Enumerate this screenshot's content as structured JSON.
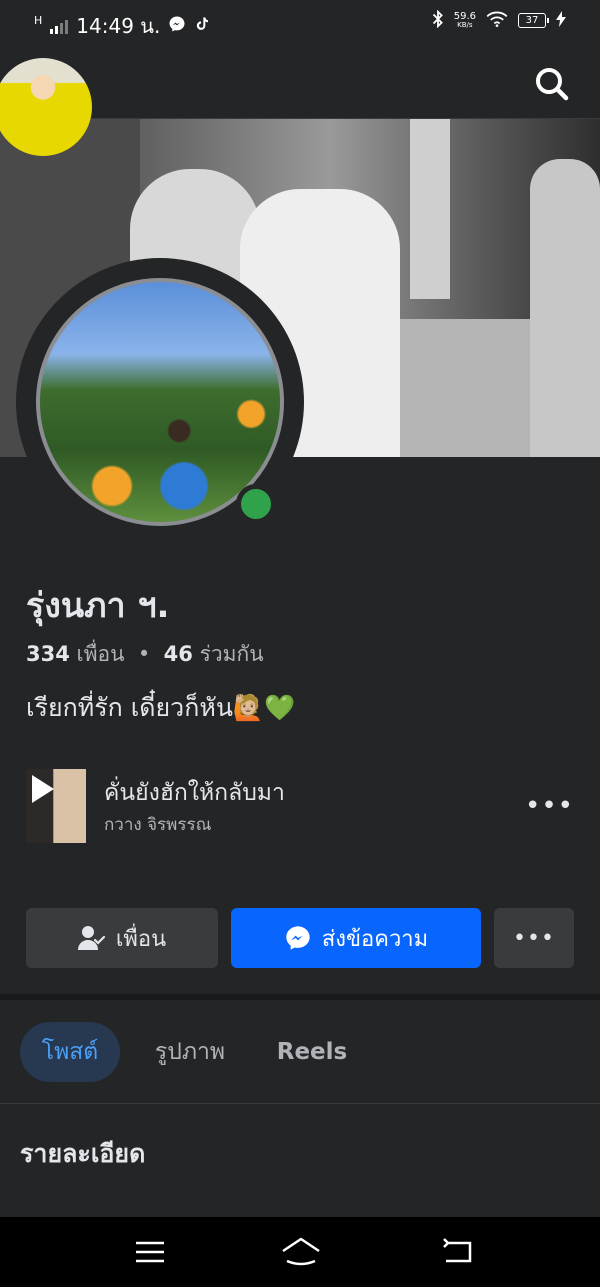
{
  "status_bar": {
    "network": "H",
    "time": "14:49 น.",
    "data_speed": "59.6",
    "data_unit": "KB/s",
    "battery": "37"
  },
  "icons": {
    "messenger_notif": "messenger-icon",
    "tiktok_notif": "tiktok-icon",
    "bluetooth": "bluetooth-icon",
    "wifi": "wifi-icon",
    "charging": "bolt-icon",
    "search": "search-icon",
    "add_friend": "friend-check-icon",
    "messenger": "messenger-icon",
    "play": "play-icon",
    "nav_menu": "menu-icon",
    "nav_home": "home-icon",
    "nav_back": "back-icon"
  },
  "profile": {
    "name": "รุ่งนภา ฯ.",
    "friends_count": "334",
    "friends_label": "เพื่อน",
    "separator": "•",
    "mutual_count": "46",
    "mutual_label": "ร่วมกัน",
    "bio": "เรียกที่รัก  เดี๋ยวก็หัน🙋🏼💚"
  },
  "music": {
    "song": "คั่นยังฮักให้กลับมา",
    "artist": "กวาง จิรพรรณ",
    "more_label": "•••"
  },
  "actions": {
    "friend_label": "เพื่อน",
    "message_label": "ส่งข้อความ",
    "more_label": "•••"
  },
  "tabs": {
    "posts": "โพสต์",
    "photos": "รูปภาพ",
    "reels": "Reels"
  },
  "details_heading": "รายละเอียด",
  "colors": {
    "background": "#242526",
    "primary_button": "#0866ff",
    "online": "#31a24c",
    "active_tab_bg": "#263951",
    "active_tab_text": "#4b9ff7"
  }
}
